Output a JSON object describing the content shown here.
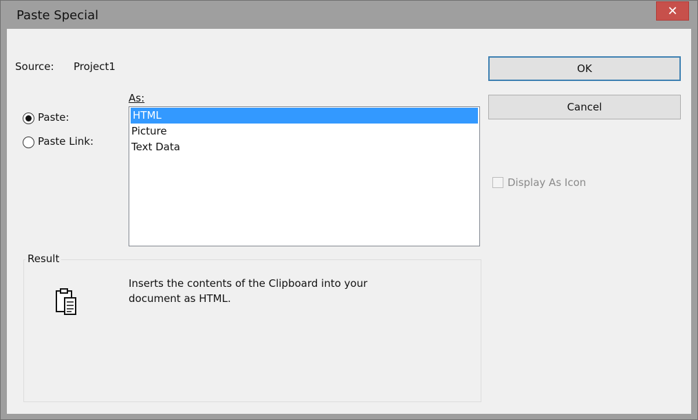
{
  "dialog": {
    "title": "Paste Special",
    "close_glyph": "✕"
  },
  "source": {
    "label": "Source:",
    "value": "Project1"
  },
  "as_label": "As:",
  "options": {
    "paste": {
      "label": "Paste:",
      "selected": true
    },
    "paste_link": {
      "label": "Paste Link:",
      "selected": false
    }
  },
  "as_list": {
    "items": [
      "HTML",
      "Picture",
      "Text Data"
    ],
    "selected_index": 0
  },
  "buttons": {
    "ok": "OK",
    "cancel": "Cancel"
  },
  "display_as_icon": {
    "label": "Display As Icon",
    "checked": false,
    "enabled": false
  },
  "result": {
    "group_label": "Result",
    "text_line1": "Inserts the contents of the Clipboard into your",
    "text_line2": "document as HTML.",
    "icon": "clipboard-paste-icon"
  },
  "colors": {
    "selection": "#3399ff",
    "close_button": "#c7504b",
    "dialog_background": "#f0f0f0",
    "disabled_text": "#8a8a8a"
  }
}
